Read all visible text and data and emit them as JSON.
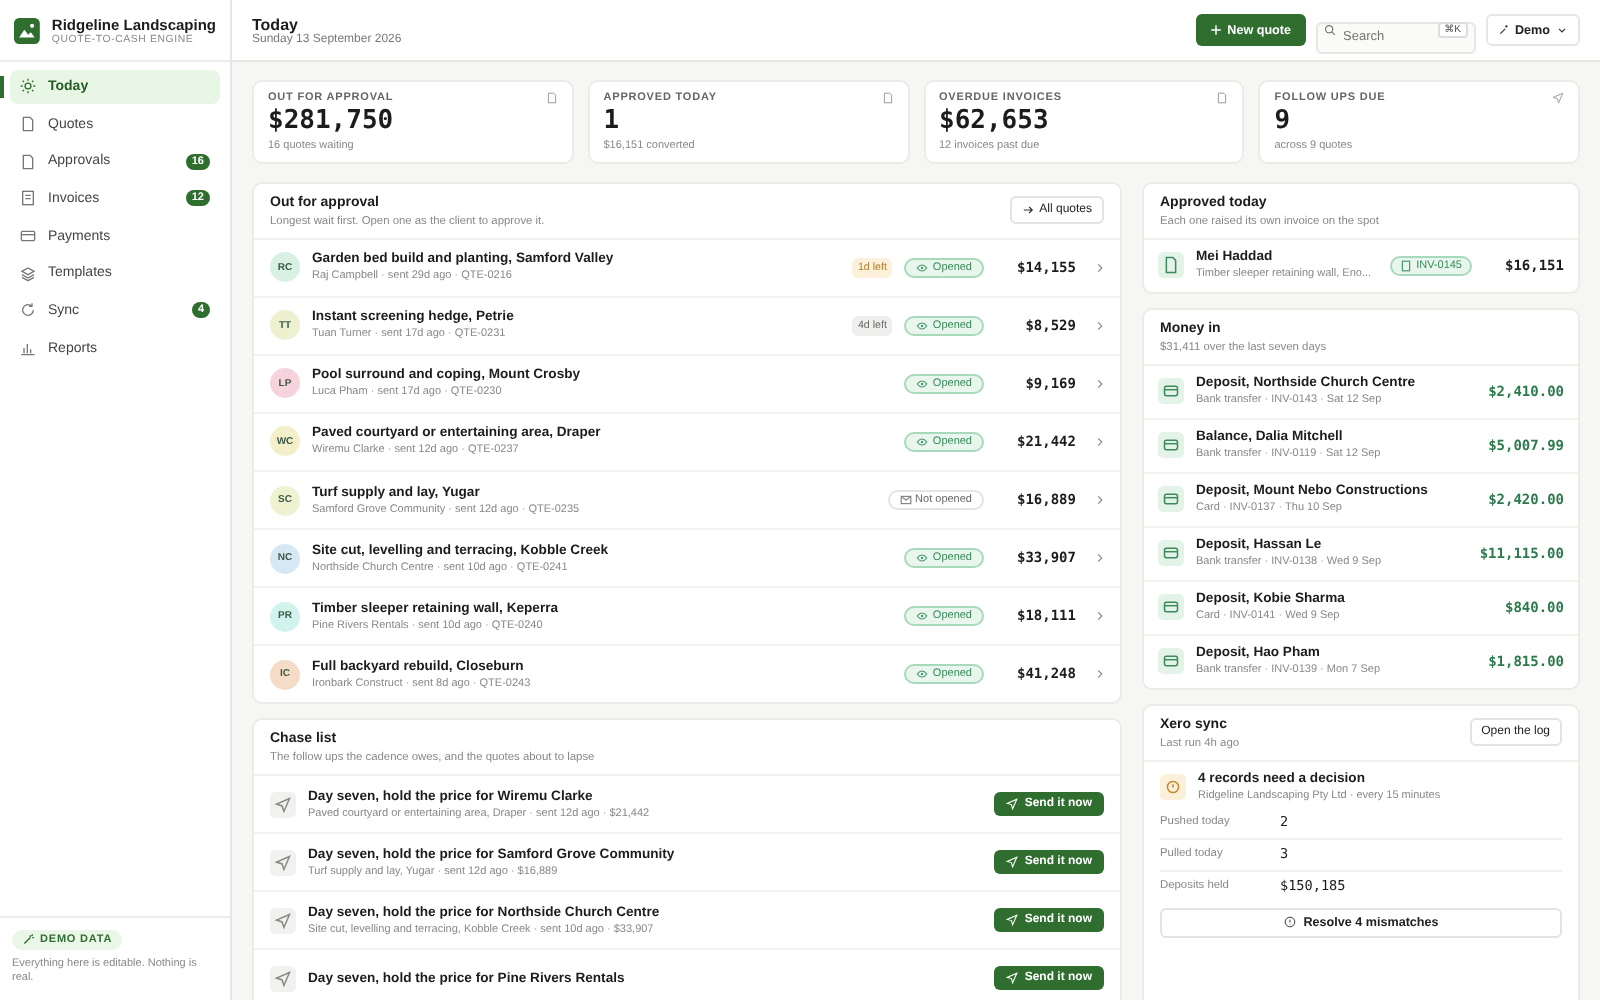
{
  "brand": {
    "name": "Ridgeline Landscaping",
    "tagline": "QUOTE-TO-CASH ENGINE"
  },
  "sidebar": {
    "items": [
      {
        "label": "Today",
        "selected": true
      },
      {
        "label": "Quotes",
        "selected": false
      },
      {
        "label": "Approvals",
        "badge": "16",
        "selected": false
      },
      {
        "label": "Invoices",
        "badge": "12",
        "selected": false
      },
      {
        "label": "Payments",
        "selected": false
      },
      {
        "label": "Templates",
        "selected": false
      },
      {
        "label": "Sync",
        "badge": "4",
        "selected": false
      },
      {
        "label": "Reports",
        "selected": false
      }
    ]
  },
  "demo": {
    "badge": "DEMO DATA",
    "note": "Everything here is editable. Nothing is real."
  },
  "header": {
    "title": "Today",
    "date": "Sunday 13 September 2026",
    "new_quote": "New quote",
    "search": {
      "placeholder": "Search",
      "shortcut": "⌘K"
    },
    "user": "Demo"
  },
  "stats": [
    {
      "label": "OUT FOR APPROVAL",
      "value": "$281,750",
      "note": "16 quotes waiting"
    },
    {
      "label": "APPROVED TODAY",
      "value": "1",
      "note": "$16,151 converted"
    },
    {
      "label": "OVERDUE INVOICES",
      "value": "$62,653",
      "note": "12 invoices past due"
    },
    {
      "label": "FOLLOW UPS DUE",
      "value": "9",
      "note": "across 9 quotes"
    }
  ],
  "approvals": {
    "title": "Out for approval",
    "subtitle": "Longest wait first. Open one as the client to approve it.",
    "link": "All quotes",
    "rows": [
      {
        "initials": "RC",
        "color": "#d8f1e2",
        "title": "Garden bed build and planting, Samford Valley",
        "meta": "Raj Campbell · sent 29d ago · QTE-0216",
        "deadline": "1d left",
        "urgent": true,
        "status": "Opened",
        "opened": true,
        "amount": "$14,155"
      },
      {
        "initials": "TT",
        "color": "#edf1cf",
        "title": "Instant screening hedge, Petrie",
        "meta": "Tuan Turner · sent 17d ago · QTE-0231",
        "deadline": "4d left",
        "urgent": false,
        "status": "Opened",
        "opened": true,
        "amount": "$8,529"
      },
      {
        "initials": "LP",
        "color": "#f6d3dd",
        "title": "Pool surround and coping, Mount Crosby",
        "meta": "Luca Pham · sent 17d ago · QTE-0230",
        "status": "Opened",
        "opened": true,
        "amount": "$9,169"
      },
      {
        "initials": "WC",
        "color": "#f3efca",
        "title": "Paved courtyard or entertaining area, Draper",
        "meta": "Wiremu Clarke · sent 12d ago · QTE-0237",
        "status": "Opened",
        "opened": true,
        "amount": "$21,442"
      },
      {
        "initials": "SC",
        "color": "#eef2d0",
        "title": "Turf supply and lay, Yugar",
        "meta": "Samford Grove Community · sent 12d ago · QTE-0235",
        "status": "Not opened",
        "opened": false,
        "amount": "$16,889"
      },
      {
        "initials": "NC",
        "color": "#d6e8f4",
        "title": "Site cut, levelling and terracing, Kobble Creek",
        "meta": "Northside Church Centre · sent 10d ago · QTE-0241",
        "status": "Opened",
        "opened": true,
        "amount": "$33,907"
      },
      {
        "initials": "PR",
        "color": "#d2f2ee",
        "title": "Timber sleeper retaining wall, Keperra",
        "meta": "Pine Rivers Rentals · sent 10d ago · QTE-0240",
        "status": "Opened",
        "opened": true,
        "amount": "$18,111"
      },
      {
        "initials": "IC",
        "color": "#f4dcc7",
        "title": "Full backyard rebuild, Closeburn",
        "meta": "Ironbark Construct · sent 8d ago · QTE-0243",
        "status": "Opened",
        "opened": true,
        "amount": "$41,248"
      }
    ]
  },
  "chase": {
    "title": "Chase list",
    "subtitle": "The follow ups the cadence owes, and the quotes about to lapse",
    "rows": [
      {
        "title": "Day seven, hold the price for Wiremu Clarke",
        "meta": "Paved courtyard or entertaining area, Draper · sent 12d ago · $21,442",
        "action": "Send it now"
      },
      {
        "title": "Day seven, hold the price for Samford Grove Community",
        "meta": "Turf supply and lay, Yugar · sent 12d ago · $16,889",
        "action": "Send it now"
      },
      {
        "title": "Day seven, hold the price for Northside Church Centre",
        "meta": "Site cut, levelling and terracing, Kobble Creek · sent 10d ago · $33,907",
        "action": "Send it now"
      },
      {
        "title": "Day seven, hold the price for Pine Rivers Rentals",
        "action": "Send it now"
      }
    ]
  },
  "approved_today": {
    "title": "Approved today",
    "subtitle": "Each one raised its own invoice on the spot",
    "rows": [
      {
        "name": "Mei Haddad",
        "meta": "Timber sleeper retaining wall, Eno...",
        "invoice": "INV-0145",
        "amount": "$16,151"
      }
    ]
  },
  "money_in": {
    "title": "Money in",
    "subtitle": "$31,411 over the last seven days",
    "rows": [
      {
        "title": "Deposit, Northside Church Centre",
        "meta": "Bank transfer · INV-0143 · Sat 12 Sep",
        "amount": "$2,410.00"
      },
      {
        "title": "Balance, Dalia Mitchell",
        "meta": "Bank transfer · INV-0119 · Sat 12 Sep",
        "amount": "$5,007.99"
      },
      {
        "title": "Deposit, Mount Nebo Constructions",
        "meta": "Card · INV-0137 · Thu 10 Sep",
        "amount": "$2,420.00"
      },
      {
        "title": "Deposit, Hassan Le",
        "meta": "Bank transfer · INV-0138 · Wed 9 Sep",
        "amount": "$11,115.00"
      },
      {
        "title": "Deposit, Kobie Sharma",
        "meta": "Card · INV-0141 · Wed 9 Sep",
        "amount": "$840.00"
      },
      {
        "title": "Deposit, Hao Pham",
        "meta": "Bank transfer · INV-0139 · Mon 7 Sep",
        "amount": "$1,815.00"
      }
    ]
  },
  "xero": {
    "title": "Xero sync",
    "subtitle": "Last run 4h ago",
    "button": "Open the log",
    "alert": {
      "title": "4 records need a decision",
      "meta": "Ridgeline Landscaping Pty Ltd · every 15 minutes"
    },
    "stats": [
      {
        "label": "Pushed today",
        "value": "2"
      },
      {
        "label": "Pulled today",
        "value": "3"
      },
      {
        "label": "Deposits held",
        "value": "$150,185"
      }
    ],
    "action": "Resolve 4 mismatches"
  }
}
